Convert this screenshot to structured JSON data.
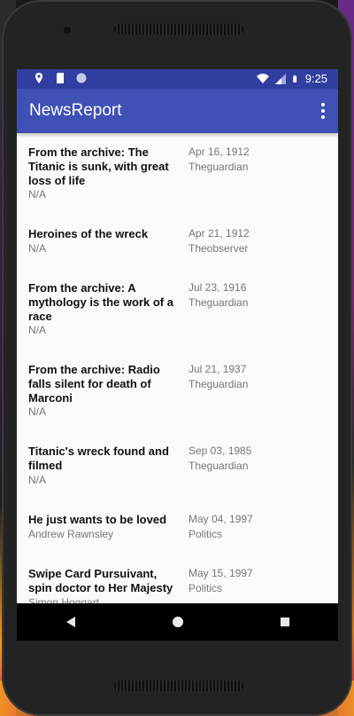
{
  "status": {
    "time": "9:25"
  },
  "app": {
    "title": "NewsReport"
  },
  "articles": [
    {
      "title": "From the archive: The Titanic is sunk, with great loss of life",
      "author": "N/A",
      "date": "Apr 16, 1912",
      "source": "Theguardian"
    },
    {
      "title": "Heroines of the wreck",
      "author": "N/A",
      "date": "Apr 21, 1912",
      "source": "Theobserver"
    },
    {
      "title": "From the archive: A mythology is the work of a race",
      "author": "N/A",
      "date": "Jul 23, 1916",
      "source": "Theguardian"
    },
    {
      "title": "From the archive: Radio falls silent for death of Marconi",
      "author": "N/A",
      "date": "Jul 21, 1937",
      "source": "Theguardian"
    },
    {
      "title": "Titanic's wreck found and filmed",
      "author": "N/A",
      "date": "Sep 03, 1985",
      "source": "Theguardian"
    },
    {
      "title": "He just wants to be loved",
      "author": "Andrew Rawnsley",
      "date": "May 04, 1997",
      "source": "Politics"
    },
    {
      "title": "Swipe Card Pursuivant, spin doctor to Her Majesty",
      "author": "Simon Hoggart",
      "date": "May 15, 1997",
      "source": "Politics"
    }
  ],
  "icons": {
    "location": "location-pin-icon",
    "sd": "sd-card-icon",
    "sync": "circle-icon",
    "wifi": "wifi-icon",
    "signal": "cell-signal-icon",
    "battery": "battery-icon",
    "overflow": "more-vert-icon",
    "back": "back-icon",
    "home": "home-icon",
    "recents": "recents-icon"
  },
  "colors": {
    "status_bar": "#303f9f",
    "app_bar": "#3f51b5"
  }
}
